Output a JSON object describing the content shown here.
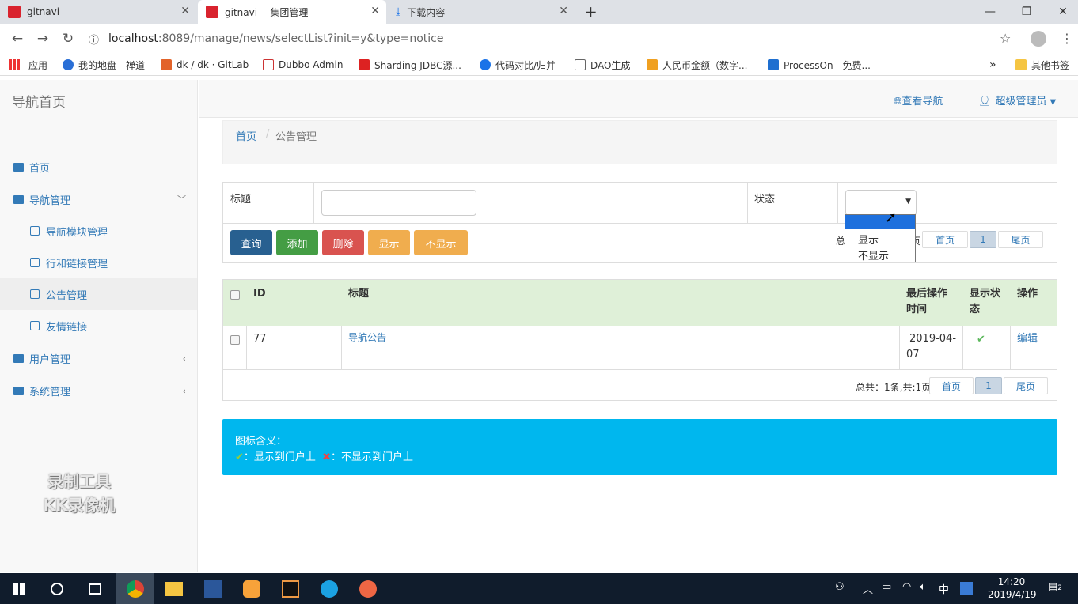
{
  "browser": {
    "tabs": [
      {
        "title": "gitnavi"
      },
      {
        "title": "gitnavi -- 集团管理"
      },
      {
        "title": "下载内容"
      }
    ],
    "url_host": "localhost",
    "url_path": ":8089/manage/news/selectList?init=y&type=notice",
    "bookmarks": [
      "应用",
      "我的地盘 - 禅道",
      "dk / dk · GitLab",
      "Dubbo Admin",
      "Sharding JDBC源...",
      "代码对比/归并",
      "DAO生成",
      "人民币金额（数字...",
      "ProcessOn - 免费...",
      "其他书签"
    ],
    "more": "»"
  },
  "sidebar": {
    "brand": "导航首页",
    "items": [
      {
        "label": "首页"
      },
      {
        "label": "导航管理"
      },
      {
        "label": "导航模块管理"
      },
      {
        "label": "行和链接管理"
      },
      {
        "label": "公告管理"
      },
      {
        "label": "友情链接"
      },
      {
        "label": "用户管理"
      },
      {
        "label": "系统管理"
      }
    ]
  },
  "topnav": {
    "view_nav": "查看导航",
    "user": "超级管理员"
  },
  "breadcrumb": {
    "home": "首页",
    "sep": "/",
    "current": "公告管理"
  },
  "filter": {
    "title_label": "标题",
    "title_value": "",
    "status_label": "状态",
    "status_options": [
      "显示",
      "不显示"
    ],
    "buttons": {
      "query": "查询",
      "add": "添加",
      "delete": "删除",
      "show": "显示",
      "hide": "不显示"
    },
    "pager": {
      "summary_prefix": "总",
      "summary_tail": "页",
      "first": "首页",
      "page": "1",
      "last": "尾页"
    }
  },
  "table": {
    "headers": {
      "id": "ID",
      "title": "标题",
      "last_time_1": "最后操作",
      "last_time_2": "时间",
      "status_1": "显示状",
      "status_2": "态",
      "op": "操作"
    },
    "rows": [
      {
        "id": "77",
        "title": "导航公告",
        "date_1": "2019-04-",
        "date_2": "07",
        "status": "✔",
        "op": "编辑"
      }
    ],
    "pager": {
      "summary": "总共：1条,共:1页",
      "first": "首页",
      "page": "1",
      "last": "尾页"
    }
  },
  "info": {
    "title": "图标含义：",
    "ok_icon": "✔",
    "ok_text": "：显示到门户上",
    "no_icon": "✖",
    "no_text": "：不显示到门户上"
  },
  "watermark": {
    "line1": "录制工具",
    "line2": "KK录像机"
  },
  "taskbar": {
    "time": "14:20",
    "date": "2019/4/19",
    "ime": "中",
    "notif": "2"
  }
}
